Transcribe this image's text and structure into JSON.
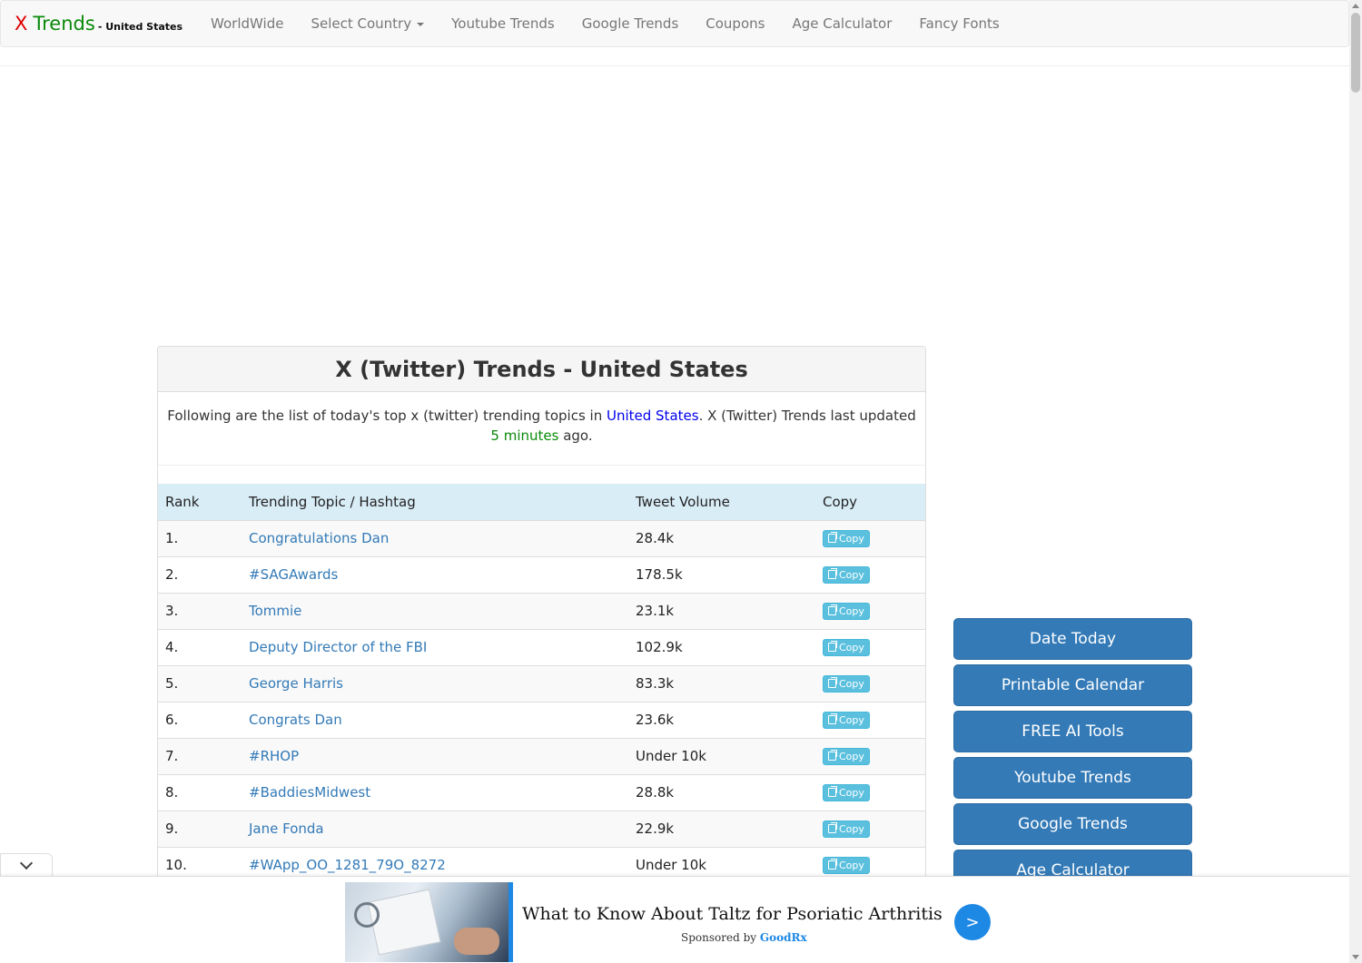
{
  "brand": {
    "x": "X",
    "trends": "Trends",
    "country": "- United States"
  },
  "nav": {
    "worldwide": "WorldWide",
    "select_country": "Select Country",
    "youtube_trends": "Youtube Trends",
    "google_trends": "Google Trends",
    "coupons": "Coupons",
    "age_calculator": "Age Calculator",
    "fancy_fonts": "Fancy Fonts"
  },
  "panel": {
    "title": "X (Twitter) Trends - United States",
    "intro_prefix": "Following are the list of today's top x (twitter) trending topics in ",
    "intro_country": "United States",
    "intro_middle": ". X (Twitter) Trends last updated ",
    "intro_updated": "5 minutes",
    "intro_suffix": " ago."
  },
  "table": {
    "headers": {
      "rank": "Rank",
      "topic": "Trending Topic / Hashtag",
      "volume": "Tweet Volume",
      "copy": "Copy"
    },
    "copy_label": "Copy",
    "rows": [
      {
        "rank": "1.",
        "topic": "Congratulations Dan",
        "volume": "28.4k"
      },
      {
        "rank": "2.",
        "topic": "#SAGAwards",
        "volume": "178.5k"
      },
      {
        "rank": "3.",
        "topic": "Tommie",
        "volume": "23.1k"
      },
      {
        "rank": "4.",
        "topic": "Deputy Director of the FBI",
        "volume": "102.9k"
      },
      {
        "rank": "5.",
        "topic": "George Harris",
        "volume": "83.3k"
      },
      {
        "rank": "6.",
        "topic": "Congrats Dan",
        "volume": "23.6k"
      },
      {
        "rank": "7.",
        "topic": "#RHOP",
        "volume": "Under 10k"
      },
      {
        "rank": "8.",
        "topic": "#BaddiesMidwest",
        "volume": "28.8k"
      },
      {
        "rank": "9.",
        "topic": "Jane Fonda",
        "volume": "22.9k"
      },
      {
        "rank": "10.",
        "topic": "#WApp_OO_1281_79O_8272",
        "volume": "Under 10k"
      }
    ]
  },
  "sidebar": {
    "buttons": [
      "Date Today",
      "Printable Calendar",
      "FREE AI Tools",
      "Youtube Trends",
      "Google Trends",
      "Age Calculator"
    ]
  },
  "ad": {
    "title": "What to Know About Taltz for Psoriatic Arthritis",
    "sponsored_by": "Sponsored by ",
    "sponsor": "GoodRx",
    "go_glyph": ">"
  },
  "colors": {
    "brand_x": "#e00000",
    "brand_trends": "#0a8a0a",
    "link": "#337ab7",
    "button": "#337ab7",
    "copy_button": "#5bc0de",
    "table_header": "#d9edf7",
    "ad_accent": "#1e88e5"
  }
}
